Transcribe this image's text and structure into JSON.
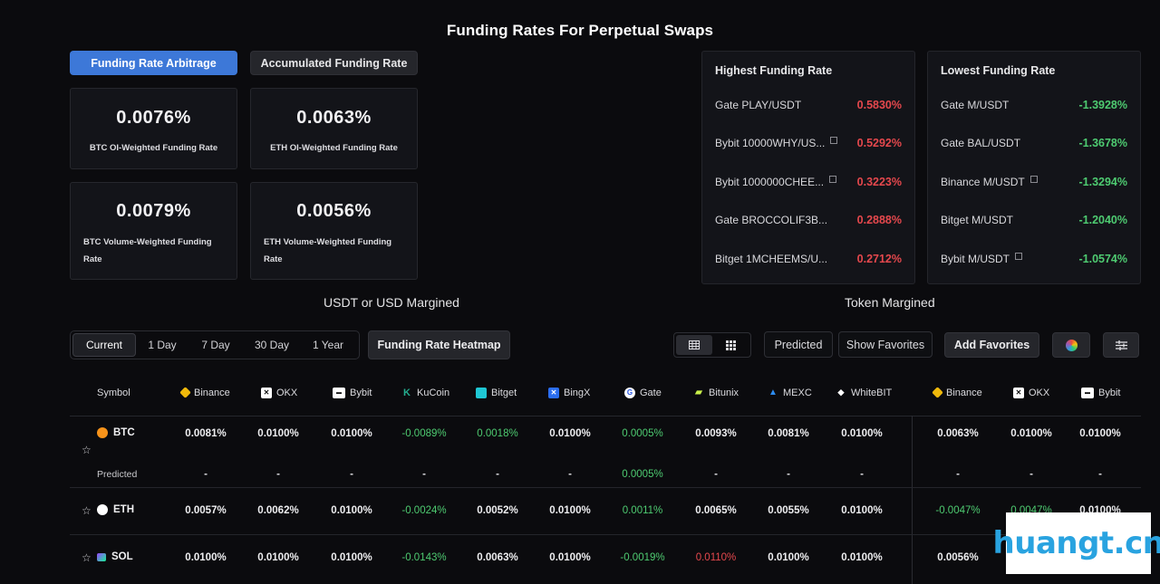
{
  "page": {
    "title": "Funding Rates For Perpetual Swaps"
  },
  "tabs": {
    "arbitrage": "Funding Rate Arbitrage",
    "accumulated": "Accumulated Funding Rate"
  },
  "stats": [
    {
      "value": "0.0076%",
      "label": "BTC OI-Weighted Funding Rate"
    },
    {
      "value": "0.0063%",
      "label": "ETH OI-Weighted Funding Rate"
    },
    {
      "value": "0.0079%",
      "label_line1": "BTC Volume-Weighted Funding",
      "label_line2": "Rate"
    },
    {
      "value": "0.0056%",
      "label_line1": "ETH Volume-Weighted Funding",
      "label_line2": "Rate"
    }
  ],
  "highest": {
    "title": "Highest Funding Rate",
    "rows": [
      {
        "name": "Gate PLAY/USDT",
        "rate": "0.5830%"
      },
      {
        "name": "Bybit 10000WHY/US...",
        "rate": "0.5292%"
      },
      {
        "name": "Bybit 1000000CHEE...",
        "rate": "0.3223%"
      },
      {
        "name": "Gate BROCCOLIF3B...",
        "rate": "0.2888%"
      },
      {
        "name": "Bitget 1MCHEEMS/U...",
        "rate": "0.2712%"
      }
    ]
  },
  "lowest": {
    "title": "Lowest Funding Rate",
    "rows": [
      {
        "name": "Gate M/USDT",
        "rate": "-1.3928%"
      },
      {
        "name": "Gate BAL/USDT",
        "rate": "-1.3678%"
      },
      {
        "name": "Binance M/USDT",
        "rate": "-1.3294%"
      },
      {
        "name": "Bitget M/USDT",
        "rate": "-1.2040%"
      },
      {
        "name": "Bybit M/USDT",
        "rate": "-1.0574%"
      }
    ]
  },
  "sections": {
    "usdt": "USDT or USD Margined",
    "token": "Token Margined"
  },
  "periods": [
    "Current",
    "1 Day",
    "7 Day",
    "30 Day",
    "1 Year"
  ],
  "toolbar": {
    "heatmap": "Funding Rate Heatmap",
    "predicted": "Predicted",
    "show_favorites": "Show Favorites",
    "add_favorites": "Add Favorites"
  },
  "table": {
    "symbol_header": "Symbol",
    "exchanges": [
      "Binance",
      "OKX",
      "Bybit",
      "KuCoin",
      "Bitget",
      "BingX",
      "Gate",
      "Bitunix",
      "MEXC",
      "WhiteBIT",
      "Binance",
      "OKX",
      "Bybit"
    ],
    "predicted_label": "Predicted",
    "rows": [
      {
        "symbol": "BTC",
        "values": [
          "0.0081%",
          "0.0100%",
          "0.0100%",
          "-0.0089%",
          "0.0018%",
          "0.0100%",
          "0.0005%",
          "0.0093%",
          "0.0081%",
          "0.0100%",
          "0.0063%",
          "0.0100%",
          "0.0100%"
        ],
        "predicted": [
          "-",
          "-",
          "-",
          "-",
          "-",
          "-",
          "0.0005%",
          "-",
          "-",
          "-",
          "-",
          "-",
          "-"
        ]
      },
      {
        "symbol": "ETH",
        "values": [
          "0.0057%",
          "0.0062%",
          "0.0100%",
          "-0.0024%",
          "0.0052%",
          "0.0100%",
          "0.0011%",
          "0.0065%",
          "0.0055%",
          "0.0100%",
          "-0.0047%",
          "0.0047%",
          "0.0100%"
        ]
      },
      {
        "symbol": "SOL",
        "values": [
          "0.0100%",
          "0.0100%",
          "0.0100%",
          "-0.0143%",
          "0.0063%",
          "0.0100%",
          "-0.0019%",
          "0.0110%",
          "0.0100%",
          "0.0100%",
          "0.0056%",
          "",
          ""
        ]
      }
    ]
  },
  "watermark": "huangt.cn",
  "colors": {
    "accent": "#3d78d8",
    "positive": "#4ecb71",
    "negative": "#e5484d"
  }
}
